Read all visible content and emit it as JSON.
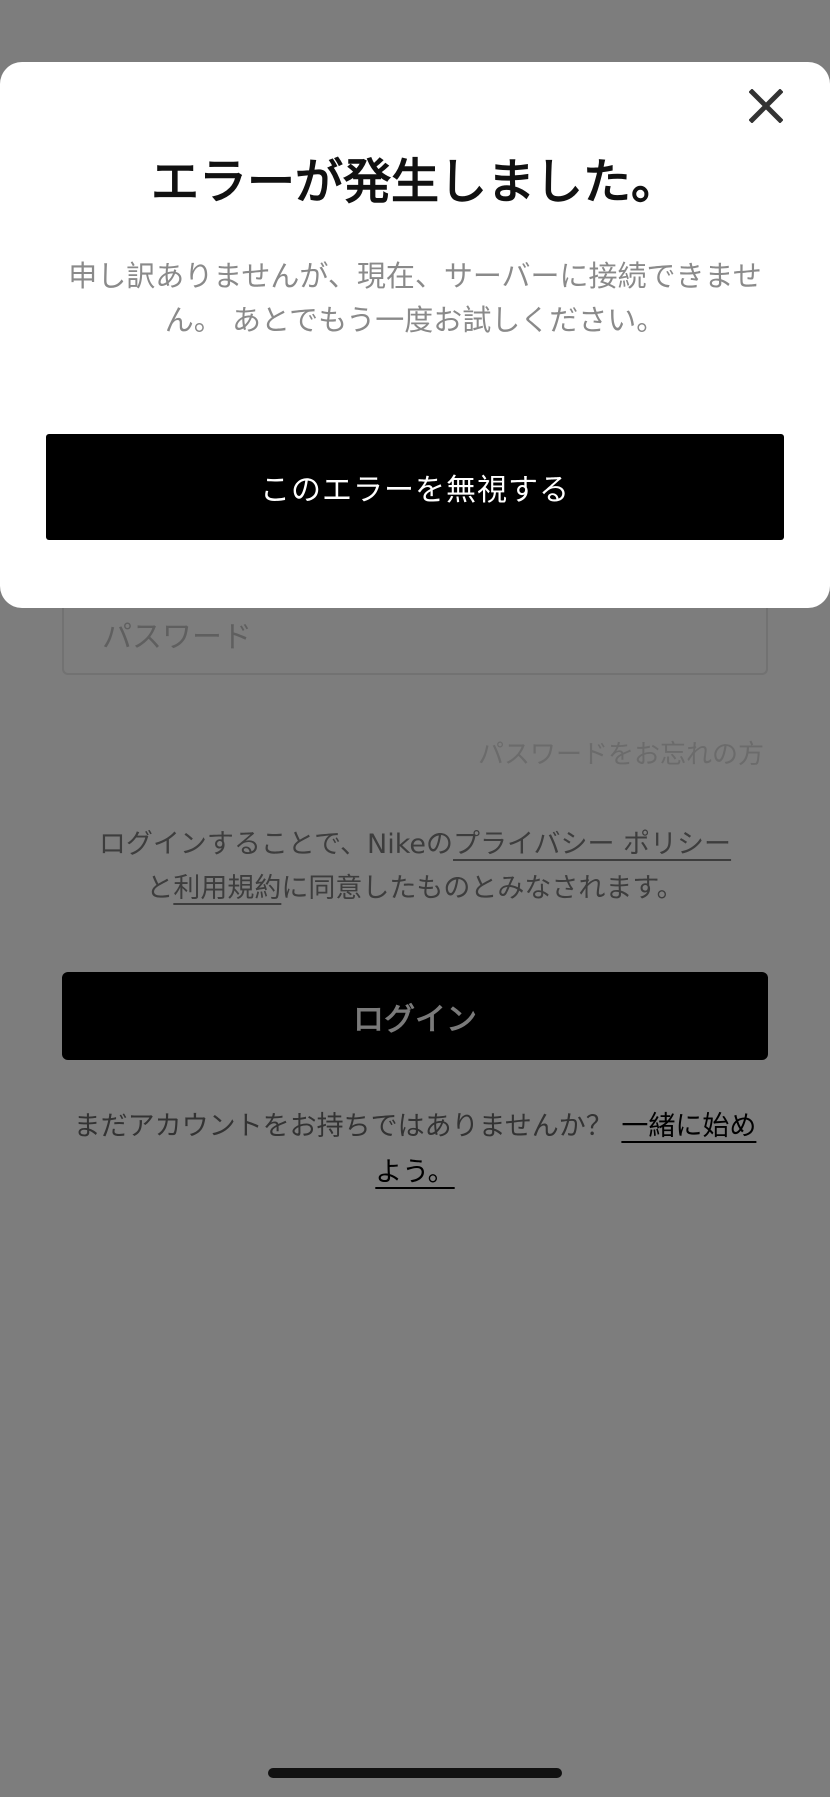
{
  "modal": {
    "title": "エラーが発生しました。",
    "message": "申し訳ありませんが、現在、サーバーに接続できません。 あとでもう一度お試しください。",
    "dismiss_label": "このエラーを無視する",
    "close_icon": "close-icon"
  },
  "login": {
    "password_placeholder": "パスワード",
    "forgot_password": "パスワードをお忘れの方",
    "terms_prefix": "ログインすることで、Nikeの",
    "privacy_policy": "プライバシー ポリシー",
    "terms_and": "と",
    "terms_of_use": "利用規約",
    "terms_suffix": "に同意したものとみなされます。",
    "login_label": "ログイン",
    "signup_prompt": "まだアカウントをお持ちではありませんか？ ",
    "signup_link": "一緒に始めよう。"
  },
  "colors": {
    "overlay": "#7d7d7d",
    "modal_background": "#ffffff",
    "button_background": "#000000"
  }
}
